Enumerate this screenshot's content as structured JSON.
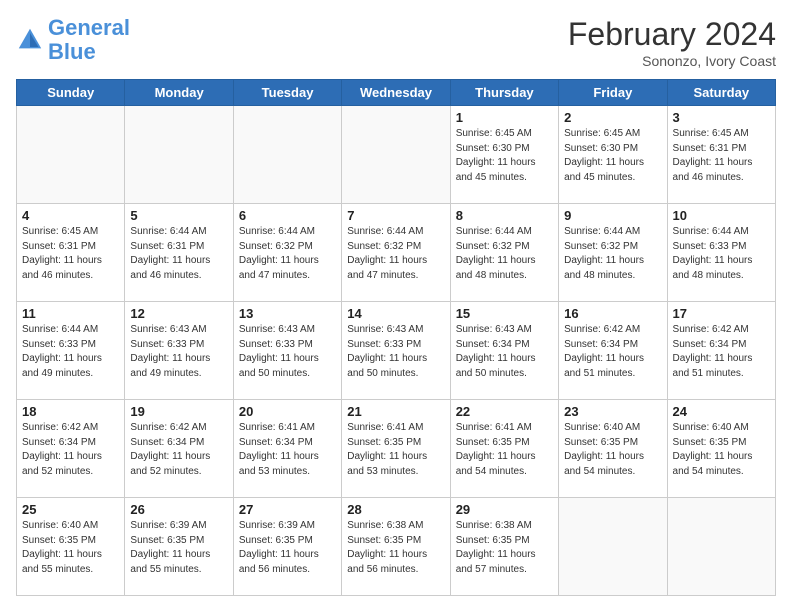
{
  "logo": {
    "line1": "General",
    "line2": "Blue"
  },
  "title": "February 2024",
  "subtitle": "Sononzo, Ivory Coast",
  "days_header": [
    "Sunday",
    "Monday",
    "Tuesday",
    "Wednesday",
    "Thursday",
    "Friday",
    "Saturday"
  ],
  "weeks": [
    [
      {
        "day": "",
        "info": ""
      },
      {
        "day": "",
        "info": ""
      },
      {
        "day": "",
        "info": ""
      },
      {
        "day": "",
        "info": ""
      },
      {
        "day": "1",
        "info": "Sunrise: 6:45 AM\nSunset: 6:30 PM\nDaylight: 11 hours\nand 45 minutes."
      },
      {
        "day": "2",
        "info": "Sunrise: 6:45 AM\nSunset: 6:30 PM\nDaylight: 11 hours\nand 45 minutes."
      },
      {
        "day": "3",
        "info": "Sunrise: 6:45 AM\nSunset: 6:31 PM\nDaylight: 11 hours\nand 46 minutes."
      }
    ],
    [
      {
        "day": "4",
        "info": "Sunrise: 6:45 AM\nSunset: 6:31 PM\nDaylight: 11 hours\nand 46 minutes."
      },
      {
        "day": "5",
        "info": "Sunrise: 6:44 AM\nSunset: 6:31 PM\nDaylight: 11 hours\nand 46 minutes."
      },
      {
        "day": "6",
        "info": "Sunrise: 6:44 AM\nSunset: 6:32 PM\nDaylight: 11 hours\nand 47 minutes."
      },
      {
        "day": "7",
        "info": "Sunrise: 6:44 AM\nSunset: 6:32 PM\nDaylight: 11 hours\nand 47 minutes."
      },
      {
        "day": "8",
        "info": "Sunrise: 6:44 AM\nSunset: 6:32 PM\nDaylight: 11 hours\nand 48 minutes."
      },
      {
        "day": "9",
        "info": "Sunrise: 6:44 AM\nSunset: 6:32 PM\nDaylight: 11 hours\nand 48 minutes."
      },
      {
        "day": "10",
        "info": "Sunrise: 6:44 AM\nSunset: 6:33 PM\nDaylight: 11 hours\nand 48 minutes."
      }
    ],
    [
      {
        "day": "11",
        "info": "Sunrise: 6:44 AM\nSunset: 6:33 PM\nDaylight: 11 hours\nand 49 minutes."
      },
      {
        "day": "12",
        "info": "Sunrise: 6:43 AM\nSunset: 6:33 PM\nDaylight: 11 hours\nand 49 minutes."
      },
      {
        "day": "13",
        "info": "Sunrise: 6:43 AM\nSunset: 6:33 PM\nDaylight: 11 hours\nand 50 minutes."
      },
      {
        "day": "14",
        "info": "Sunrise: 6:43 AM\nSunset: 6:33 PM\nDaylight: 11 hours\nand 50 minutes."
      },
      {
        "day": "15",
        "info": "Sunrise: 6:43 AM\nSunset: 6:34 PM\nDaylight: 11 hours\nand 50 minutes."
      },
      {
        "day": "16",
        "info": "Sunrise: 6:42 AM\nSunset: 6:34 PM\nDaylight: 11 hours\nand 51 minutes."
      },
      {
        "day": "17",
        "info": "Sunrise: 6:42 AM\nSunset: 6:34 PM\nDaylight: 11 hours\nand 51 minutes."
      }
    ],
    [
      {
        "day": "18",
        "info": "Sunrise: 6:42 AM\nSunset: 6:34 PM\nDaylight: 11 hours\nand 52 minutes."
      },
      {
        "day": "19",
        "info": "Sunrise: 6:42 AM\nSunset: 6:34 PM\nDaylight: 11 hours\nand 52 minutes."
      },
      {
        "day": "20",
        "info": "Sunrise: 6:41 AM\nSunset: 6:34 PM\nDaylight: 11 hours\nand 53 minutes."
      },
      {
        "day": "21",
        "info": "Sunrise: 6:41 AM\nSunset: 6:35 PM\nDaylight: 11 hours\nand 53 minutes."
      },
      {
        "day": "22",
        "info": "Sunrise: 6:41 AM\nSunset: 6:35 PM\nDaylight: 11 hours\nand 54 minutes."
      },
      {
        "day": "23",
        "info": "Sunrise: 6:40 AM\nSunset: 6:35 PM\nDaylight: 11 hours\nand 54 minutes."
      },
      {
        "day": "24",
        "info": "Sunrise: 6:40 AM\nSunset: 6:35 PM\nDaylight: 11 hours\nand 54 minutes."
      }
    ],
    [
      {
        "day": "25",
        "info": "Sunrise: 6:40 AM\nSunset: 6:35 PM\nDaylight: 11 hours\nand 55 minutes."
      },
      {
        "day": "26",
        "info": "Sunrise: 6:39 AM\nSunset: 6:35 PM\nDaylight: 11 hours\nand 55 minutes."
      },
      {
        "day": "27",
        "info": "Sunrise: 6:39 AM\nSunset: 6:35 PM\nDaylight: 11 hours\nand 56 minutes."
      },
      {
        "day": "28",
        "info": "Sunrise: 6:38 AM\nSunset: 6:35 PM\nDaylight: 11 hours\nand 56 minutes."
      },
      {
        "day": "29",
        "info": "Sunrise: 6:38 AM\nSunset: 6:35 PM\nDaylight: 11 hours\nand 57 minutes."
      },
      {
        "day": "",
        "info": ""
      },
      {
        "day": "",
        "info": ""
      }
    ]
  ]
}
